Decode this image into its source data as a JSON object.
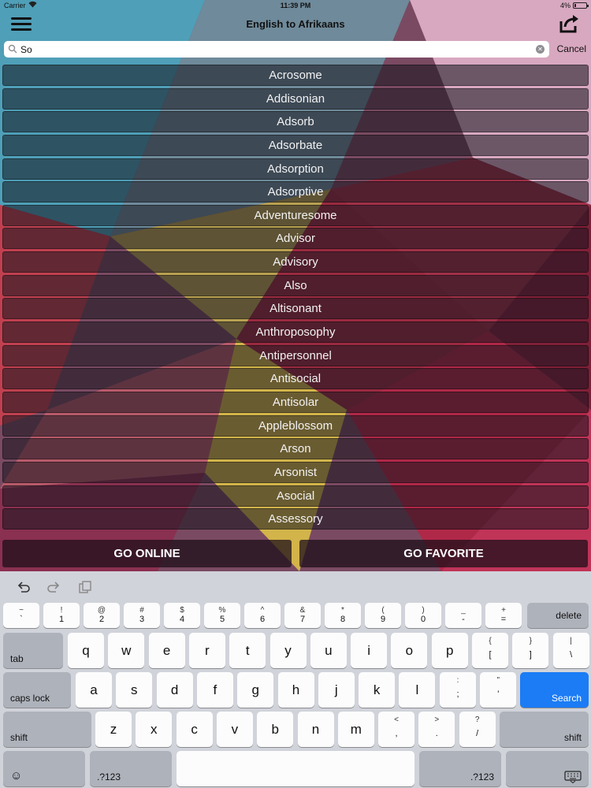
{
  "status_bar": {
    "carrier": "Carrier",
    "time": "11:39 PM",
    "battery": "4%"
  },
  "nav": {
    "title": "English to Afrikaans",
    "menu_icon": "hamburger-menu-icon",
    "share_icon": "share-icon"
  },
  "search": {
    "value": "So",
    "cancel_label": "Cancel",
    "clear_icon": "clear-icon"
  },
  "results": [
    "Acrosome",
    "Addisonian",
    "Adsorb",
    "Adsorbate",
    "Adsorption",
    "Adsorptive",
    "Adventuresome",
    "Advisor",
    "Advisory",
    "Also",
    "Altisonant",
    "Anthroposophy",
    "Antipersonnel",
    "Antisocial",
    "Antisolar",
    "Appleblossom",
    "Arson",
    "Arsonist",
    "Asocial",
    "Assessory"
  ],
  "buttons": {
    "go_online": "GO ONLINE",
    "go_favorite": "GO FAVORITE"
  },
  "keyboard": {
    "number_row": [
      {
        "top": "~",
        "bot": "`"
      },
      {
        "top": "!",
        "bot": "1"
      },
      {
        "top": "@",
        "bot": "2"
      },
      {
        "top": "#",
        "bot": "3"
      },
      {
        "top": "$",
        "bot": "4"
      },
      {
        "top": "%",
        "bot": "5"
      },
      {
        "top": "^",
        "bot": "6"
      },
      {
        "top": "&",
        "bot": "7"
      },
      {
        "top": "*",
        "bot": "8"
      },
      {
        "top": "(",
        "bot": "9"
      },
      {
        "top": ")",
        "bot": "0"
      },
      {
        "top": "_",
        "bot": "-"
      },
      {
        "top": "+",
        "bot": "="
      }
    ],
    "delete": "delete",
    "tab": "tab",
    "row_qwerty": [
      "q",
      "w",
      "e",
      "r",
      "t",
      "y",
      "u",
      "i",
      "o",
      "p"
    ],
    "row_qwerty_symbols": [
      {
        "top": "{",
        "bot": "["
      },
      {
        "top": "}",
        "bot": "]"
      },
      {
        "top": "|",
        "bot": "\\"
      }
    ],
    "caps_lock": "caps lock",
    "row_asdf": [
      "a",
      "s",
      "d",
      "f",
      "g",
      "h",
      "j",
      "k",
      "l"
    ],
    "row_asdf_symbols": [
      {
        "top": ":",
        "bot": ";"
      },
      {
        "top": "\"",
        "bot": "'"
      }
    ],
    "search": "Search",
    "shift": "shift",
    "row_zxcv": [
      "z",
      "x",
      "c",
      "v",
      "b",
      "n",
      "m"
    ],
    "row_zxcv_symbols": [
      {
        "top": "<",
        "bot": ","
      },
      {
        "top": ">",
        "bot": "."
      },
      {
        "top": "?",
        "bot": "/"
      }
    ],
    "numbers_label": ".?123",
    "emoji_icon": "emoji-icon",
    "hide_keyboard_icon": "keyboard-dismiss-icon",
    "undo_icon": "undo-icon",
    "redo_icon": "redo-icon",
    "paste_icon": "paste-icon"
  }
}
